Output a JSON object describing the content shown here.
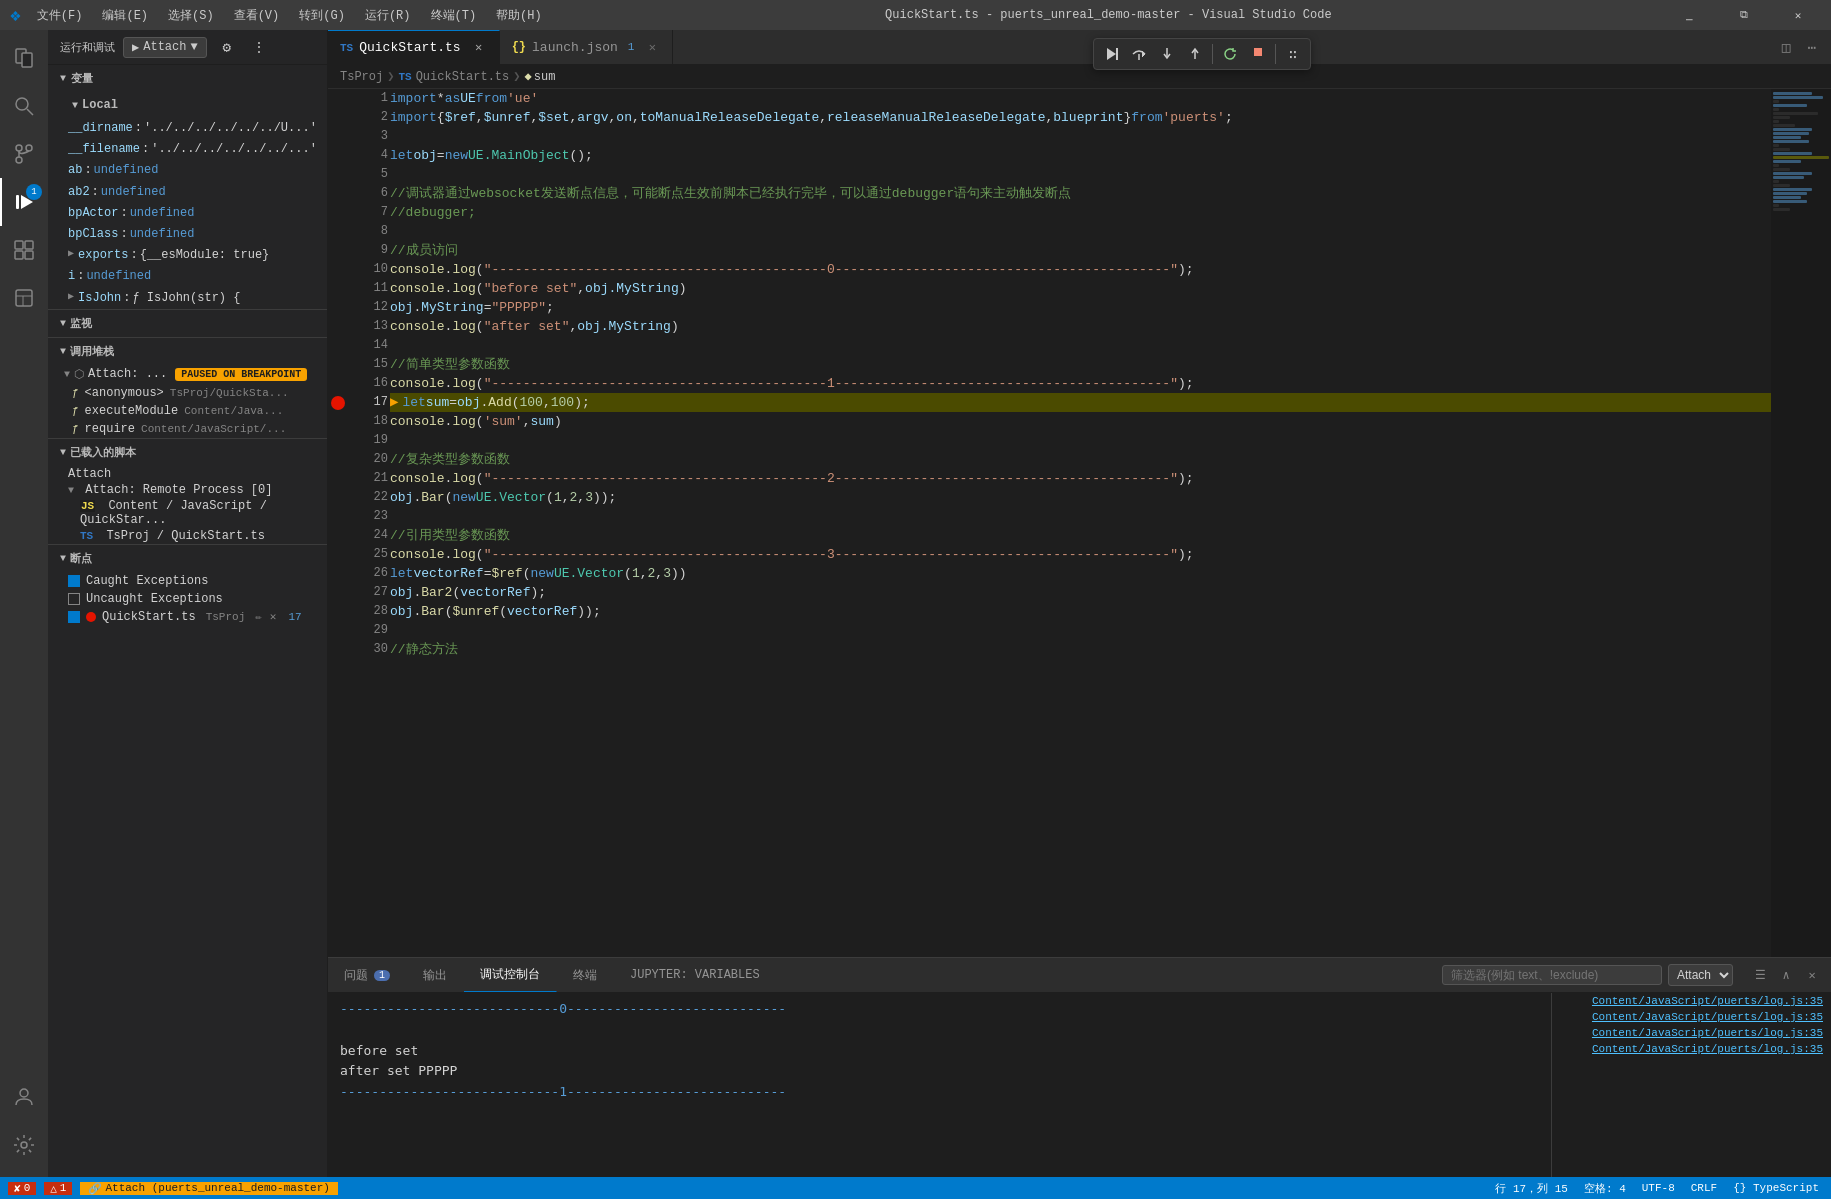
{
  "app": {
    "title": "QuickStart.ts - puerts_unreal_demo-master - Visual Studio Code",
    "logo": "VS"
  },
  "titlebar": {
    "menus": [
      "文件(F)",
      "编辑(E)",
      "选择(S)",
      "查看(V)",
      "转到(G)",
      "运行(R)",
      "终端(T)",
      "帮助(H)"
    ],
    "title": "QuickStart.ts - puerts_unreal_demo-master - Visual Studio Code",
    "btns": [
      "⊟",
      "❐",
      "✕"
    ]
  },
  "activity": {
    "items": [
      {
        "icon": "≡",
        "name": "explorer",
        "label": "资源管理器"
      },
      {
        "icon": "⎇",
        "name": "source-control",
        "label": "源代码管理"
      },
      {
        "icon": "🔍",
        "name": "search",
        "label": "搜索"
      },
      {
        "icon": "⚙",
        "name": "run-debug",
        "label": "运行和调试",
        "active": true,
        "badge": "1"
      },
      {
        "icon": "⬛",
        "name": "extensions",
        "label": "扩展"
      },
      {
        "icon": "📄",
        "name": "explorer2",
        "label": "资源管理器"
      }
    ],
    "bottom": [
      {
        "icon": "👤",
        "name": "account"
      },
      {
        "icon": "⚙",
        "name": "settings"
      }
    ]
  },
  "debug_toolbar": {
    "label": "运行和调试",
    "attach_label": "Attach",
    "settings_title": "打开 launch.json",
    "more_title": "更多"
  },
  "sidebar": {
    "variables_header": "变量",
    "local_header": "Local",
    "variables": [
      {
        "name": "__dirname",
        "value": "'../../../../../../U...'",
        "expandable": false
      },
      {
        "name": "__filename",
        "value": "'../../../../../../...'",
        "expandable": false
      },
      {
        "name": "ab",
        "value": "undefined",
        "type": "undefined"
      },
      {
        "name": "ab2",
        "value": "undefined",
        "type": "undefined"
      },
      {
        "name": "bpActor",
        "value": "undefined",
        "type": "undefined"
      },
      {
        "name": "bpClass",
        "value": "undefined",
        "type": "undefined"
      },
      {
        "name": "exports",
        "value": "{__esModule: true}",
        "expandable": true
      },
      {
        "name": "i",
        "value": "undefined",
        "type": "undefined"
      },
      {
        "name": "IsJohn",
        "value": "ƒ IsJohn(str) {",
        "expandable": true
      }
    ],
    "watch_header": "监视",
    "call_stack_header": "调用堆栈",
    "call_stack_items": [
      {
        "name": "Attach: ...",
        "badge": "PAUSED ON BREAKPOINT"
      },
      {
        "name": "<anonymous>",
        "sub": "TsProj/QuickSta...",
        "icon": "func"
      },
      {
        "name": "executeModule",
        "sub": "Content/Java...",
        "icon": "func"
      },
      {
        "name": "require",
        "sub": "Content/JavaScript/...",
        "icon": "func"
      }
    ],
    "loaded_scripts_header": "已载入的脚本",
    "loaded_scripts": [
      {
        "name": "Attach"
      },
      {
        "name": "Attach: Remote Process [0]",
        "expandable": true,
        "items": [
          {
            "name": "Content / JavaScript / QuickStar...",
            "icon": "JS"
          },
          {
            "name": "TsProj / QuickStart.ts",
            "icon": "TS"
          }
        ]
      }
    ],
    "breakpoints_header": "断点",
    "breakpoints": [
      {
        "name": "Caught Exceptions",
        "checked": true
      },
      {
        "name": "Uncaught Exceptions",
        "checked": false
      },
      {
        "name": "QuickStart.ts",
        "sub": "TsProj",
        "checked": true,
        "dot": "red",
        "has_dot": true,
        "line": "17"
      }
    ]
  },
  "tabs": [
    {
      "name": "QuickStart.ts",
      "icon": "TS",
      "active": true,
      "dirty": false,
      "closeable": true
    },
    {
      "name": "launch.json",
      "icon": "JS",
      "active": false,
      "closeable": true,
      "number": "1"
    }
  ],
  "breadcrumb": {
    "items": [
      "TsProj",
      "TS QuickStart.ts",
      "sum"
    ]
  },
  "editor": {
    "filename": "QuickStart.ts",
    "lines": [
      {
        "num": 1,
        "code": "import_kw import _op* _kw as _ident UE _op from _str'ue'"
      },
      {
        "num": 2,
        "code": "import_kw import _punct{_prop $ref_punct, _prop $unref_punct, _prop $set_punct, _prop argv_punct, _prop on_punct, _prop toManualReleaseDelegate_punct, _prop releaseManualReleaseDelegate_punct, _prop blueprint_punct} _kw from _str'puerts'_punct;"
      },
      {
        "num": 3,
        "code": ""
      },
      {
        "num": 4,
        "code": "_kw let _var_c obj _op= _kw new _type UE.MainObject_punct();"
      },
      {
        "num": 5,
        "code": ""
      },
      {
        "num": 6,
        "code": "_cmt //调试器通过websocket发送断点信息，可能断点生效前脚本已经执行完毕，可以通过debugger语句来主动触发断点"
      },
      {
        "num": 7,
        "code": "_cmt //debugger;"
      },
      {
        "num": 8,
        "code": ""
      },
      {
        "num": 9,
        "code": "_cmt //成员访问"
      },
      {
        "num": 10,
        "code": "_fn console_punct._fn log_punct(_str\"-------------------------------------------0-------------------------------------------\"_punct);"
      },
      {
        "num": 11,
        "code": "_fn console_punct._fn log_punct(_str\"before set\"_punct, _prop obj.MyString_punct)"
      },
      {
        "num": 12,
        "code": "_prop obj_punct._prop MyString _op= _str\"PPPPP\"_punct;"
      },
      {
        "num": 13,
        "code": "_fn console_punct._fn log_punct(_str\"after set\"_punct, _prop obj.MyString_punct)"
      },
      {
        "num": 14,
        "code": ""
      },
      {
        "num": 15,
        "code": "_cmt //简单类型参数函数"
      },
      {
        "num": 16,
        "code": "_fn console_punct._fn log_punct(_str\"-------------------------------------------1-------------------------------------------\"_punct);"
      },
      {
        "num": 17,
        "code": "_kw let _var_c sum _op= _var_c obj_punct._fn Add_punct(_num 100_punct, _num 100_punct);",
        "current": true,
        "breakpoint": true
      },
      {
        "num": 18,
        "code": "_fn console_punct._fn log_punct(_str'sum'_punct, _var_c sum_punct)"
      },
      {
        "num": 19,
        "code": ""
      },
      {
        "num": 20,
        "code": "_cmt //复杂类型参数函数"
      },
      {
        "num": 21,
        "code": "_fn console_punct._fn log_punct(_str\"-------------------------------------------2-------------------------------------------\"_punct);"
      },
      {
        "num": 22,
        "code": "_prop obj_punct._fn Bar_punct(_kw new _type UE.Vector_punct(_num 1_punct, _num 2_punct, _num 3_punct)_punct);"
      },
      {
        "num": 23,
        "code": ""
      },
      {
        "num": 24,
        "code": "_cmt //引用类型参数函数"
      },
      {
        "num": 25,
        "code": "_fn console_punct._fn log_punct(_str\"-------------------------------------------3-------------------------------------------\"_punct);"
      },
      {
        "num": 26,
        "code": "_kw let _var_c vectorRef _op= _fn $ref_punct(_kw new _type UE.Vector_punct(_num 1_punct, _num 2_punct, _num 3_punct)_punct)"
      },
      {
        "num": 27,
        "code": "_prop obj_punct._fn Bar2_punct(_var_c vectorRef_punct);"
      },
      {
        "num": 28,
        "code": "_prop obj_punct._fn Bar_punct(_fn $unref_punct(_var_c vectorRef_punct)_punct);"
      },
      {
        "num": 29,
        "code": ""
      },
      {
        "num": 30,
        "code": "_cmt //静态方法"
      }
    ]
  },
  "debug_float": {
    "buttons": [
      {
        "icon": "▶",
        "title": "继续"
      },
      {
        "icon": "↷",
        "title": "单步跳过"
      },
      {
        "icon": "↓",
        "title": "单步进入"
      },
      {
        "icon": "↑",
        "title": "单步跳出"
      },
      {
        "icon": "↺",
        "title": "重启"
      },
      {
        "icon": "⬛",
        "title": "停止"
      }
    ]
  },
  "panel": {
    "tabs": [
      {
        "label": "问题",
        "badge": "1",
        "active": false
      },
      {
        "label": "输出",
        "active": false
      },
      {
        "label": "调试控制台",
        "active": true
      },
      {
        "label": "终端",
        "active": false
      },
      {
        "label": "JUPYTER: VARIABLES",
        "active": false
      }
    ],
    "filter_placeholder": "筛选器(例如 text、!exclude)",
    "filter_dropdown": "Attach",
    "terminal_lines": [
      {
        "text": "----------------------------0----------------------------",
        "type": "dash"
      },
      {
        "text": "",
        "type": "empty"
      },
      {
        "text": "before set",
        "type": "text"
      },
      {
        "text": "after set PPPPP",
        "type": "text"
      },
      {
        "text": "----------------------------1----------------------------",
        "type": "dash"
      }
    ],
    "right_links": [
      "Content/JavaScript/puerts/log.js:35",
      "Content/JavaScript/puerts/log.js:35",
      "Content/JavaScript/puerts/log.js:35",
      "Content/JavaScript/puerts/log.js:35"
    ]
  },
  "statusbar": {
    "left_items": [
      {
        "icon": "⊕",
        "text": "0",
        "type": "error"
      },
      {
        "icon": "⚠",
        "text": "1",
        "type": "warning"
      },
      {
        "icon": "🔗",
        "text": "Attach (puerts_unreal_demo-master)",
        "type": "debug-bg"
      }
    ],
    "right_items": [
      {
        "text": "行 17，列 15"
      },
      {
        "text": "空格: 4"
      },
      {
        "text": "UTF-8"
      },
      {
        "text": "CRLF"
      },
      {
        "text": "{} TypeScript"
      }
    ]
  }
}
